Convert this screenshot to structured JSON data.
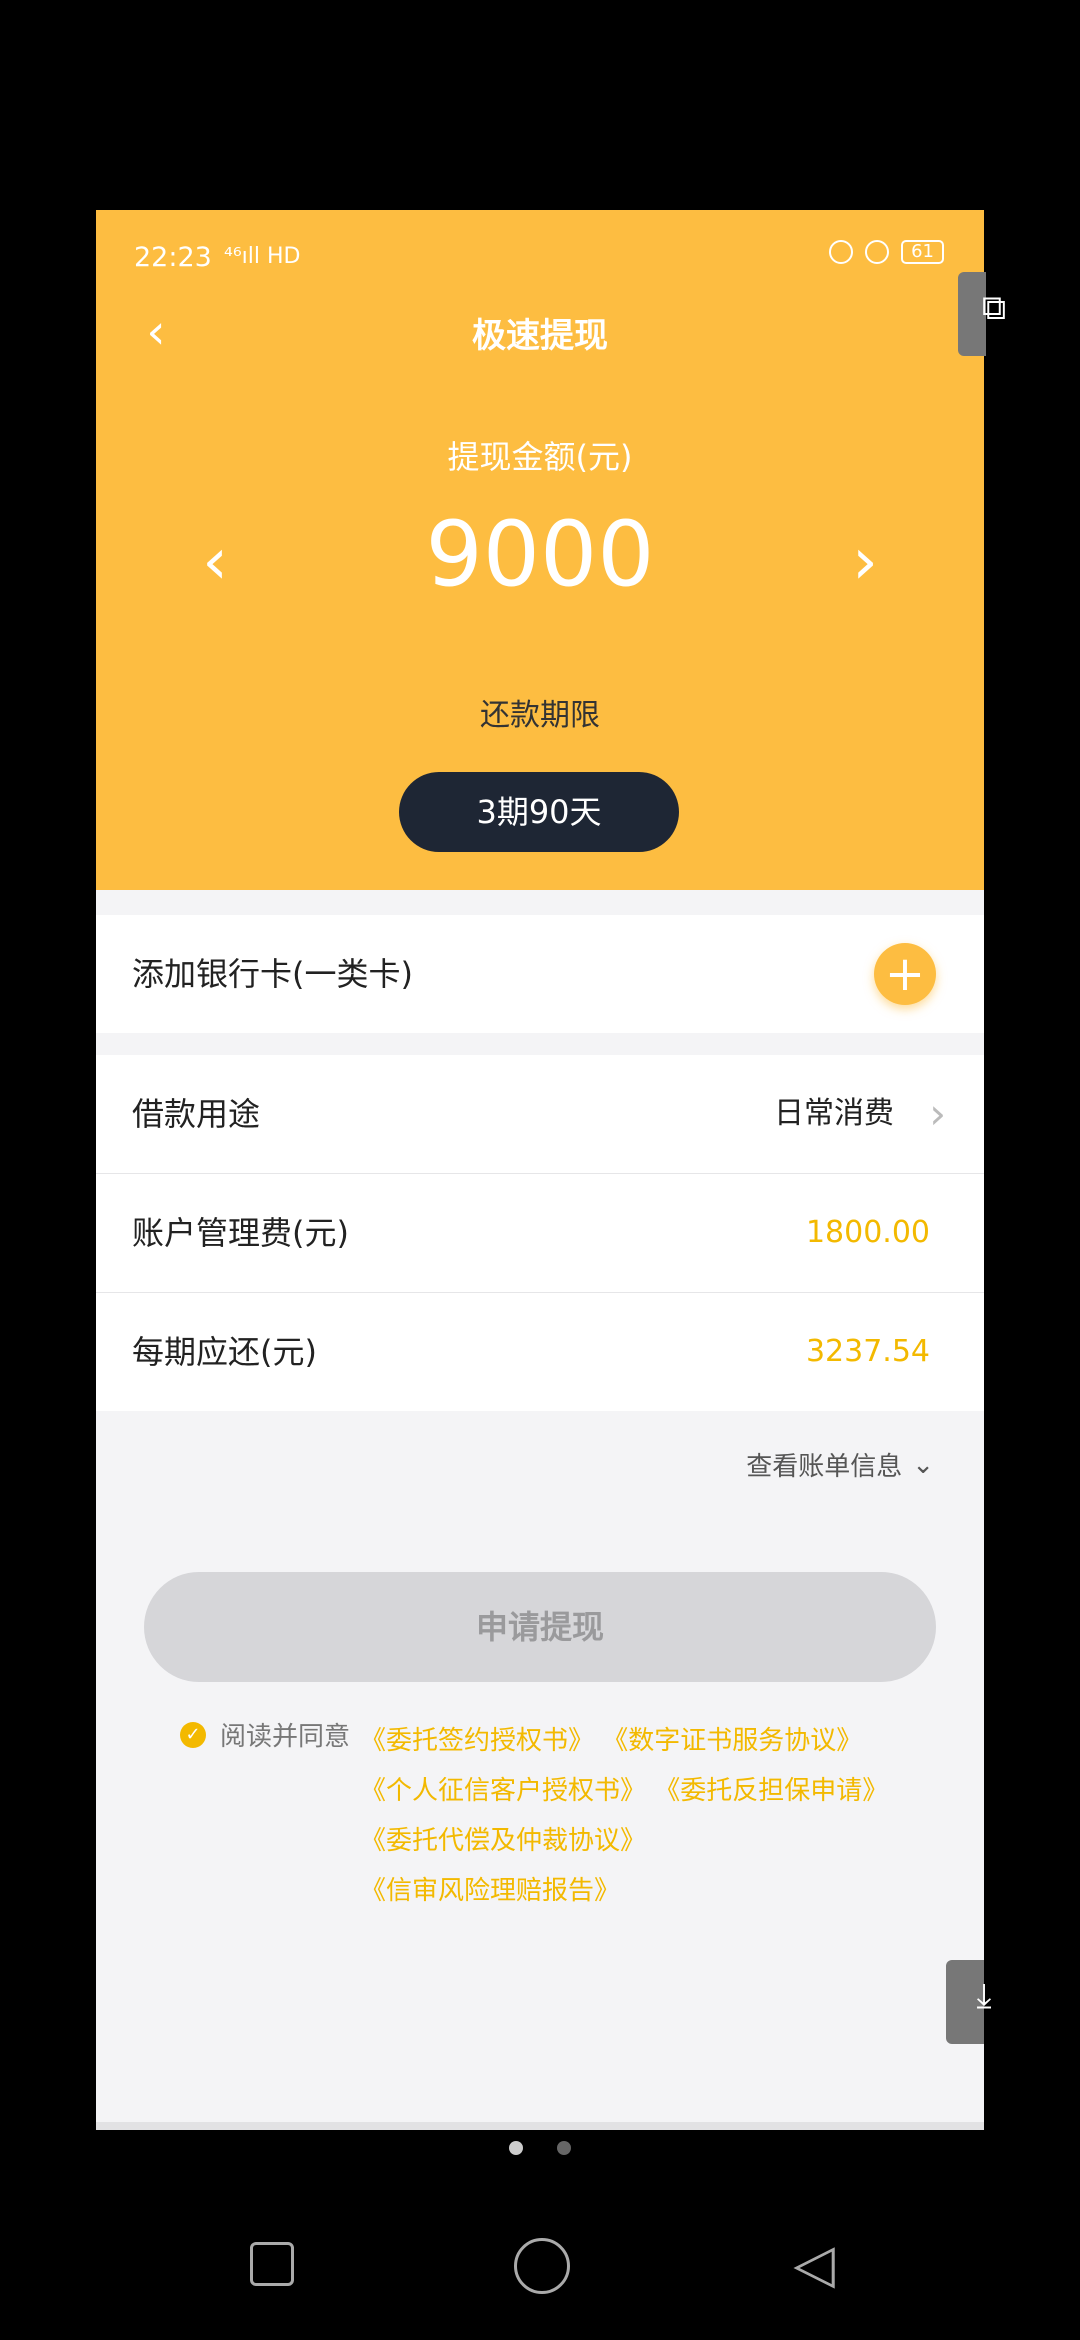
{
  "status": {
    "time": "22:23",
    "signal": "⁴⁶ıll HD",
    "battery": "61"
  },
  "header": {
    "title": "极速提现",
    "amount_label": "提现金额(元)",
    "amount_value": "9000",
    "term_label": "还款期限",
    "term_value": "3期90天"
  },
  "bank": {
    "label": "添加银行卡(一类卡)"
  },
  "rows": [
    {
      "label": "借款用途",
      "value": "日常消费"
    },
    {
      "label": "账户管理费(元)",
      "value": "1800.00"
    },
    {
      "label": "每期应还(元)",
      "value": "3237.54"
    }
  ],
  "bill_link": "查看账单信息",
  "apply_button": "申请提现",
  "agreement": {
    "lead": "阅读并同意",
    "links": [
      "《委托签约授权书》",
      "《数字证书服务协议》",
      "《个人征信客户授权书》",
      "《委托反担保申请》",
      "《委托代偿及仲裁协议》",
      "《信审风险理赔报告》"
    ]
  },
  "colors": {
    "accent": "#fdbd41",
    "gold_text": "#f3b900",
    "pill": "#1e2634"
  }
}
